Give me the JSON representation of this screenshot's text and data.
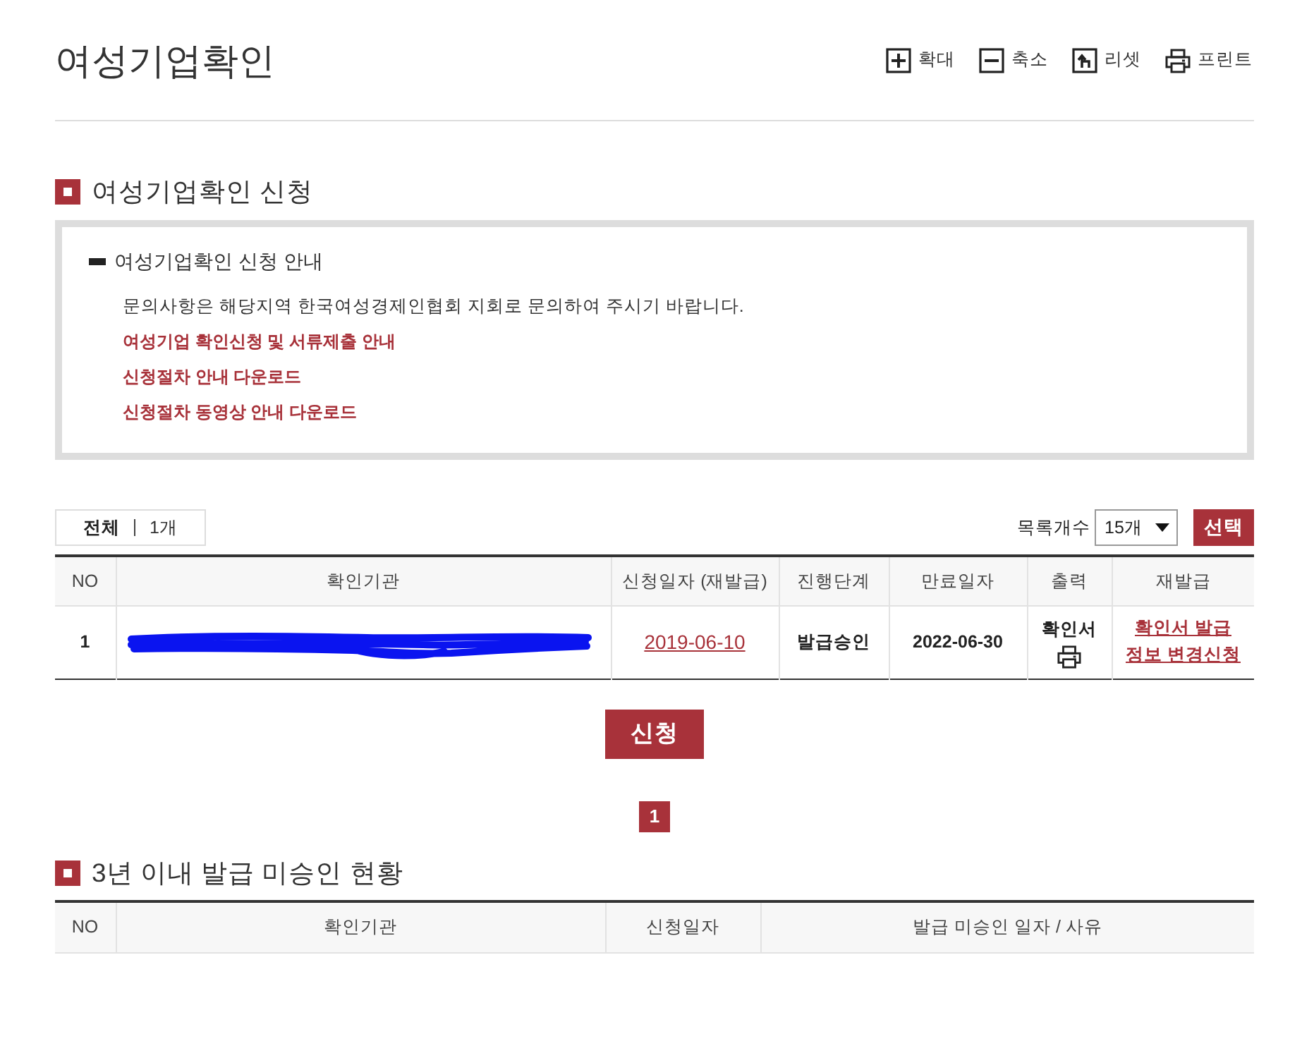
{
  "page_title": "여성기업확인",
  "toolbar": [
    {
      "kind": "zoom_in",
      "label": "확대"
    },
    {
      "kind": "zoom_out",
      "label": "축소"
    },
    {
      "kind": "reset",
      "label": "리셋"
    },
    {
      "kind": "print",
      "label": "프린트"
    }
  ],
  "application": {
    "heading": "여성기업확인 신청",
    "guide": {
      "title": "여성기업확인 신청 안내",
      "lines": [
        {
          "kind": "text",
          "text": "문의사항은 해당지역 한국여성경제인협회 지회로 문의하여 주시기 바랍니다."
        },
        {
          "kind": "link",
          "text": "여성기업 확인신청 및 서류제출 안내"
        },
        {
          "kind": "link",
          "text": "신청절차 안내 다운로드"
        },
        {
          "kind": "link",
          "text": "신청절차 동영상 안내 다운로드"
        }
      ]
    }
  },
  "list_bar": {
    "total_label": "전체",
    "total_count": "1개",
    "page_size_label": "목록개수",
    "page_size": "15개",
    "select_button": "선택"
  },
  "table": {
    "columns": [
      "NO",
      "확인기관",
      "신청일자 (재발급)",
      "진행단계",
      "만료일자",
      "출력",
      "재발급"
    ],
    "rows": [
      {
        "no": "1",
        "institution_redacted": true,
        "application_date": "2019-06-10",
        "stage": "발급승인",
        "expiry_date": "2022-06-30",
        "output_label": "확인서",
        "reissue_links": [
          "확인서 발급",
          "정보 변경신청"
        ]
      }
    ]
  },
  "apply_button": "신청",
  "pagination": [
    {
      "label": "1",
      "selected": true
    }
  ],
  "unapproved": {
    "heading": "3년 이내 발급 미승인 현황",
    "columns": [
      "NO",
      "확인기관",
      "신청일자",
      "발급 미승인 일자 / 사유"
    ]
  }
}
